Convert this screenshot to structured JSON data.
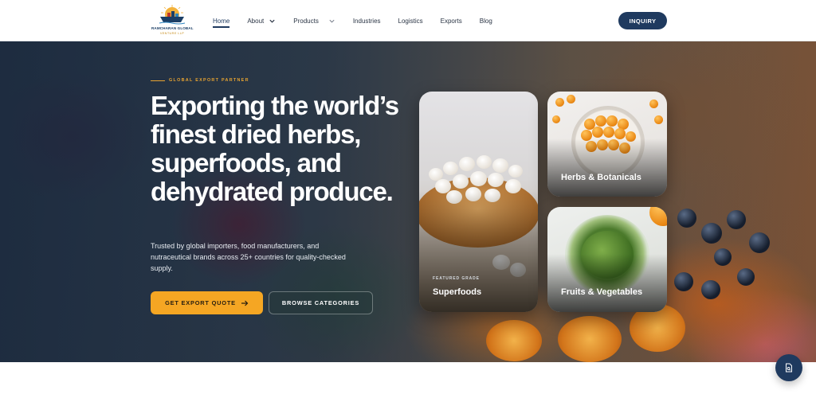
{
  "brand": {
    "name": "RAMCHARAN GLOBAL",
    "subtitle": "VENTURE LLP"
  },
  "nav": {
    "items": [
      {
        "label": "Home",
        "active": true,
        "dropdown": false
      },
      {
        "label": "About",
        "active": false,
        "dropdown": true
      },
      {
        "label": "Products",
        "active": false,
        "dropdown": true
      },
      {
        "label": "Industries",
        "active": false,
        "dropdown": false
      },
      {
        "label": "Logistics",
        "active": false,
        "dropdown": false
      },
      {
        "label": "Exports",
        "active": false,
        "dropdown": false
      },
      {
        "label": "Blog",
        "active": false,
        "dropdown": false
      }
    ],
    "cta_label": "INQUIRY"
  },
  "hero": {
    "eyebrow": "GLOBAL EXPORT PARTNER",
    "headline": "Exporting the world’s finest dried herbs, superfoods, and dehydrated produce.",
    "subcopy": "Trusted by global importers, food manufacturers, and nutraceutical brands across 25+ countries for quality-checked supply.",
    "primary_button": "GET EXPORT QUOTE",
    "secondary_button": "BROWSE CATEGORIES"
  },
  "cards": {
    "featured": {
      "eyebrow": "FEATURED GRADE",
      "title": "Superfoods"
    },
    "herbs": {
      "title": "Herbs & Botanicals"
    },
    "fruits": {
      "title": "Fruits & Vegetables"
    }
  },
  "colors": {
    "navy": "#1f3a5f",
    "accent_orange": "#f5a623",
    "eyebrow_gold": "#e8a431"
  },
  "icons": {
    "dropdown": "chevron-down-icon",
    "quote_arrow": "arrow-right-icon",
    "floating_action": "document-search-icon"
  }
}
